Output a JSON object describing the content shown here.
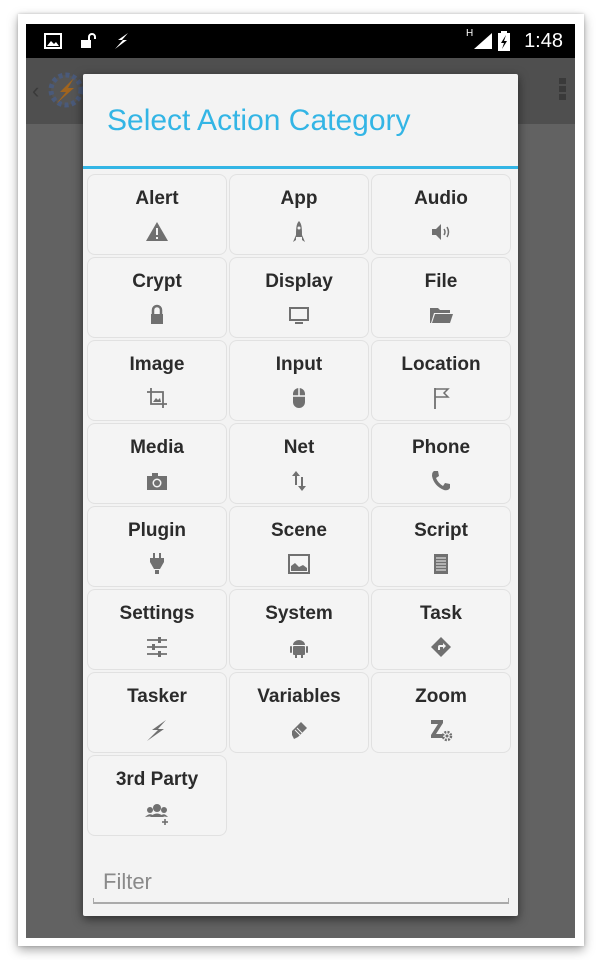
{
  "status_bar": {
    "time": "1:48",
    "left_icons": [
      "image-icon",
      "unlock-icon",
      "tasker-bolt-icon"
    ],
    "right_icons": [
      "signal-h-icon",
      "battery-charging-icon"
    ],
    "network_label": "H"
  },
  "background_app_bar": {
    "back_glyph": "‹",
    "logo": "tasker-logo-icon",
    "menu": "overflow-menu-icon"
  },
  "dialog": {
    "title": "Select Action Category",
    "accent_color": "#33b5e5",
    "categories": [
      {
        "label": "Alert",
        "icon": "warning-icon"
      },
      {
        "label": "App",
        "icon": "rocket-icon"
      },
      {
        "label": "Audio",
        "icon": "speaker-icon"
      },
      {
        "label": "Crypt",
        "icon": "lock-icon"
      },
      {
        "label": "Display",
        "icon": "monitor-icon"
      },
      {
        "label": "File",
        "icon": "folder-icon"
      },
      {
        "label": "Image",
        "icon": "crop-icon"
      },
      {
        "label": "Input",
        "icon": "mouse-icon"
      },
      {
        "label": "Location",
        "icon": "flag-icon"
      },
      {
        "label": "Media",
        "icon": "camera-icon"
      },
      {
        "label": "Net",
        "icon": "up-down-arrows-icon"
      },
      {
        "label": "Phone",
        "icon": "phone-icon"
      },
      {
        "label": "Plugin",
        "icon": "plug-icon"
      },
      {
        "label": "Scene",
        "icon": "picture-icon"
      },
      {
        "label": "Script",
        "icon": "document-lines-icon"
      },
      {
        "label": "Settings",
        "icon": "sliders-icon"
      },
      {
        "label": "System",
        "icon": "android-icon"
      },
      {
        "label": "Task",
        "icon": "direction-sign-icon"
      },
      {
        "label": "Tasker",
        "icon": "lightning-icon"
      },
      {
        "label": "Variables",
        "icon": "pencil-tag-icon"
      },
      {
        "label": "Zoom",
        "icon": "zoom-gear-icon"
      },
      {
        "label": "3rd Party",
        "icon": "group-add-icon"
      }
    ],
    "filter": {
      "placeholder": "Filter",
      "value": ""
    }
  }
}
